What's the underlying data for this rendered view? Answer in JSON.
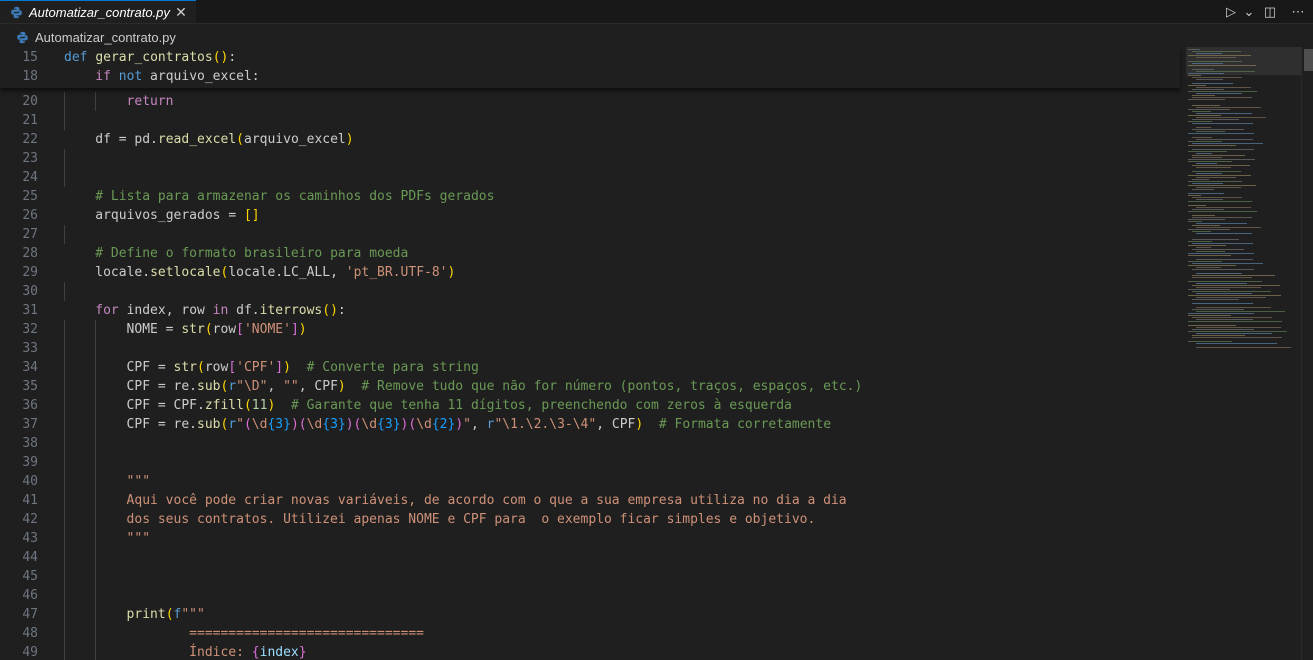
{
  "tab": {
    "label": "Automatizar_contrato.py",
    "close_glyph": "✕"
  },
  "actions": {
    "run_glyph": "▷",
    "run_menu_glyph": "⌄",
    "split_glyph": "◫",
    "more_glyph": "⋯"
  },
  "breadcrumb": {
    "file": "Automatizar_contrato.py"
  },
  "colors": {
    "keyword": "#569cd6",
    "control": "#c586c0",
    "function": "#dcdcaa",
    "string": "#ce9178",
    "comment": "#6a9955",
    "number": "#b5cea8",
    "variable": "#9cdcfe",
    "escape": "#d7ba7d",
    "bracket_yellow": "#ffd700",
    "bracket_purple": "#da70d6",
    "bracket_blue": "#179fff",
    "accent": "#0078d4",
    "python_icon": "#3d7ab8"
  },
  "icons": {
    "file": "python-file-icon"
  },
  "sticky": [
    {
      "num": "15",
      "indent": 0,
      "tokens": [
        [
          "kw",
          "def"
        ],
        [
          "p",
          " "
        ],
        [
          "fn",
          "gerar_contratos"
        ],
        [
          "br1",
          "()"
        ],
        [
          "p",
          ":"
        ]
      ]
    },
    {
      "num": "18",
      "indent": 1,
      "tokens": [
        [
          "ctl",
          "if"
        ],
        [
          "p",
          " "
        ],
        [
          "kw",
          "not"
        ],
        [
          "p",
          " arquivo_excel:"
        ]
      ]
    }
  ],
  "lines": [
    {
      "num": "20",
      "indent": 2,
      "tokens": [
        [
          "ctl",
          "return"
        ]
      ]
    },
    {
      "num": "21",
      "indent": 1,
      "tokens": []
    },
    {
      "num": "22",
      "indent": 1,
      "tokens": [
        [
          "p",
          "df = pd."
        ],
        [
          "fn",
          "read_excel"
        ],
        [
          "br1",
          "("
        ],
        [
          "p",
          "arquivo_excel"
        ],
        [
          "br1",
          ")"
        ]
      ]
    },
    {
      "num": "23",
      "indent": 1,
      "tokens": []
    },
    {
      "num": "24",
      "indent": 1,
      "tokens": []
    },
    {
      "num": "25",
      "indent": 1,
      "tokens": [
        [
          "com",
          "# Lista para armazenar os caminhos dos PDFs gerados"
        ]
      ]
    },
    {
      "num": "26",
      "indent": 1,
      "tokens": [
        [
          "p",
          "arquivos_gerados = "
        ],
        [
          "br1",
          "[]"
        ]
      ]
    },
    {
      "num": "27",
      "indent": 1,
      "tokens": []
    },
    {
      "num": "28",
      "indent": 1,
      "tokens": [
        [
          "com",
          "# Define o formato brasileiro para moeda"
        ]
      ]
    },
    {
      "num": "29",
      "indent": 1,
      "tokens": [
        [
          "p",
          "locale."
        ],
        [
          "fn",
          "setlocale"
        ],
        [
          "br1",
          "("
        ],
        [
          "p",
          "locale.LC_ALL, "
        ],
        [
          "str",
          "'pt_BR.UTF-8'"
        ],
        [
          "br1",
          ")"
        ]
      ]
    },
    {
      "num": "30",
      "indent": 1,
      "tokens": []
    },
    {
      "num": "31",
      "indent": 1,
      "tokens": [
        [
          "ctl",
          "for"
        ],
        [
          "p",
          " index, row "
        ],
        [
          "ctl",
          "in"
        ],
        [
          "p",
          " df."
        ],
        [
          "fn",
          "iterrows"
        ],
        [
          "br1",
          "()"
        ],
        [
          "p",
          ":"
        ]
      ]
    },
    {
      "num": "32",
      "indent": 2,
      "tokens": [
        [
          "p",
          "NOME = "
        ],
        [
          "fn",
          "str"
        ],
        [
          "br1",
          "("
        ],
        [
          "p",
          "row"
        ],
        [
          "br2",
          "["
        ],
        [
          "str",
          "'NOME'"
        ],
        [
          "br2",
          "]"
        ],
        [
          "br1",
          ")"
        ]
      ]
    },
    {
      "num": "33",
      "indent": 2,
      "tokens": []
    },
    {
      "num": "34",
      "indent": 2,
      "tokens": [
        [
          "p",
          "CPF = "
        ],
        [
          "fn",
          "str"
        ],
        [
          "br1",
          "("
        ],
        [
          "p",
          "row"
        ],
        [
          "br2",
          "["
        ],
        [
          "str",
          "'CPF'"
        ],
        [
          "br2",
          "]"
        ],
        [
          "br1",
          ")"
        ],
        [
          "p",
          "  "
        ],
        [
          "com",
          "# Converte para string"
        ]
      ]
    },
    {
      "num": "35",
      "indent": 2,
      "tokens": [
        [
          "p",
          "CPF = re."
        ],
        [
          "fn",
          "sub"
        ],
        [
          "br1",
          "("
        ],
        [
          "kw",
          "r"
        ],
        [
          "str",
          "\"\\D\""
        ],
        [
          "p",
          ", "
        ],
        [
          "str",
          "\"\""
        ],
        [
          "p",
          ", CPF"
        ],
        [
          "br1",
          ")"
        ],
        [
          "p",
          "  "
        ],
        [
          "com",
          "# Remove tudo que não for número (pontos, traços, espaços, etc.)"
        ]
      ]
    },
    {
      "num": "36",
      "indent": 2,
      "tokens": [
        [
          "p",
          "CPF = CPF."
        ],
        [
          "fn",
          "zfill"
        ],
        [
          "br1",
          "("
        ],
        [
          "num",
          "11"
        ],
        [
          "br1",
          ")"
        ],
        [
          "p",
          "  "
        ],
        [
          "com",
          "# Garante que tenha 11 dígitos, preenchendo com zeros à esquerda"
        ]
      ]
    },
    {
      "num": "37",
      "indent": 2,
      "tokens": [
        [
          "p",
          "CPF = re."
        ],
        [
          "fn",
          "sub"
        ],
        [
          "br1",
          "("
        ],
        [
          "kw",
          "r"
        ],
        [
          "str",
          "\""
        ],
        [
          "br2",
          "("
        ],
        [
          "str",
          "\\d"
        ],
        [
          "br3",
          "{3}"
        ],
        [
          "br2",
          ")("
        ],
        [
          "str",
          "\\d"
        ],
        [
          "br3",
          "{3}"
        ],
        [
          "br2",
          ")("
        ],
        [
          "str",
          "\\d"
        ],
        [
          "br3",
          "{3}"
        ],
        [
          "br2",
          ")("
        ],
        [
          "str",
          "\\d"
        ],
        [
          "br3",
          "{2}"
        ],
        [
          "br2",
          ")"
        ],
        [
          "str",
          "\""
        ],
        [
          "p",
          ", "
        ],
        [
          "kw",
          "r"
        ],
        [
          "str",
          "\"\\1.\\2.\\3-\\4\""
        ],
        [
          "p",
          ", CPF"
        ],
        [
          "br1",
          ")"
        ],
        [
          "p",
          "  "
        ],
        [
          "com",
          "# Formata corretamente"
        ]
      ]
    },
    {
      "num": "38",
      "indent": 2,
      "tokens": []
    },
    {
      "num": "39",
      "indent": 2,
      "tokens": []
    },
    {
      "num": "40",
      "indent": 2,
      "tokens": [
        [
          "str",
          "\"\"\""
        ]
      ]
    },
    {
      "num": "41",
      "indent": 2,
      "tokens": [
        [
          "str",
          "Aqui você pode criar novas variáveis, de acordo com o que a sua empresa utiliza no dia a dia"
        ]
      ]
    },
    {
      "num": "42",
      "indent": 2,
      "tokens": [
        [
          "str",
          "dos seus contratos. Utilizei apenas NOME e CPF para  o exemplo ficar simples e objetivo."
        ]
      ]
    },
    {
      "num": "43",
      "indent": 2,
      "tokens": [
        [
          "str",
          "\"\"\""
        ]
      ]
    },
    {
      "num": "44",
      "indent": 2,
      "tokens": []
    },
    {
      "num": "45",
      "indent": 2,
      "tokens": []
    },
    {
      "num": "46",
      "indent": 2,
      "tokens": []
    },
    {
      "num": "47",
      "indent": 2,
      "tokens": [
        [
          "fn",
          "print"
        ],
        [
          "br1",
          "("
        ],
        [
          "kw",
          "f"
        ],
        [
          "str",
          "\"\"\""
        ]
      ]
    },
    {
      "num": "48",
      "indent": 2,
      "tokens": [
        [
          "p",
          "        "
        ],
        [
          "str",
          "=============================="
        ]
      ]
    },
    {
      "num": "49",
      "indent": 2,
      "tokens": [
        [
          "p",
          "        "
        ],
        [
          "str",
          "Índice: "
        ],
        [
          "br2",
          "{"
        ],
        [
          "var",
          "index"
        ],
        [
          "br2",
          "}"
        ]
      ]
    }
  ]
}
